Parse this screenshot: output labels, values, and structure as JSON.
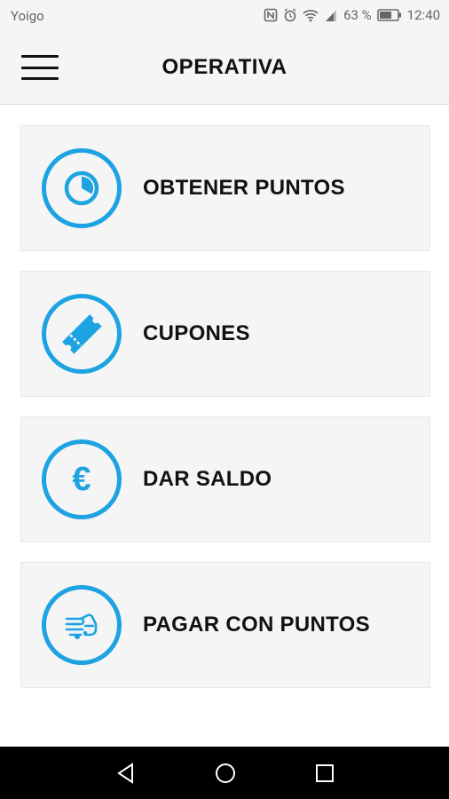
{
  "status_bar": {
    "carrier": "Yoigo",
    "battery": "63 %",
    "time": "12:40"
  },
  "header": {
    "title": "OPERATIVA",
    "menu_icon": "hamburger-icon"
  },
  "menu": {
    "items": [
      {
        "label": "OBTENER PUNTOS",
        "icon": "timer-icon"
      },
      {
        "label": "CUPONES",
        "icon": "ticket-icon"
      },
      {
        "label": "DAR SALDO",
        "icon": "euro-icon",
        "glyph": "€"
      },
      {
        "label": "PAGAR CON PUNTOS",
        "icon": "hand-payment-icon"
      }
    ]
  },
  "colors": {
    "accent": "#1ea3e2",
    "card_bg": "#f5f5f5",
    "header_bg": "#f5f5f5",
    "text": "#111111"
  }
}
